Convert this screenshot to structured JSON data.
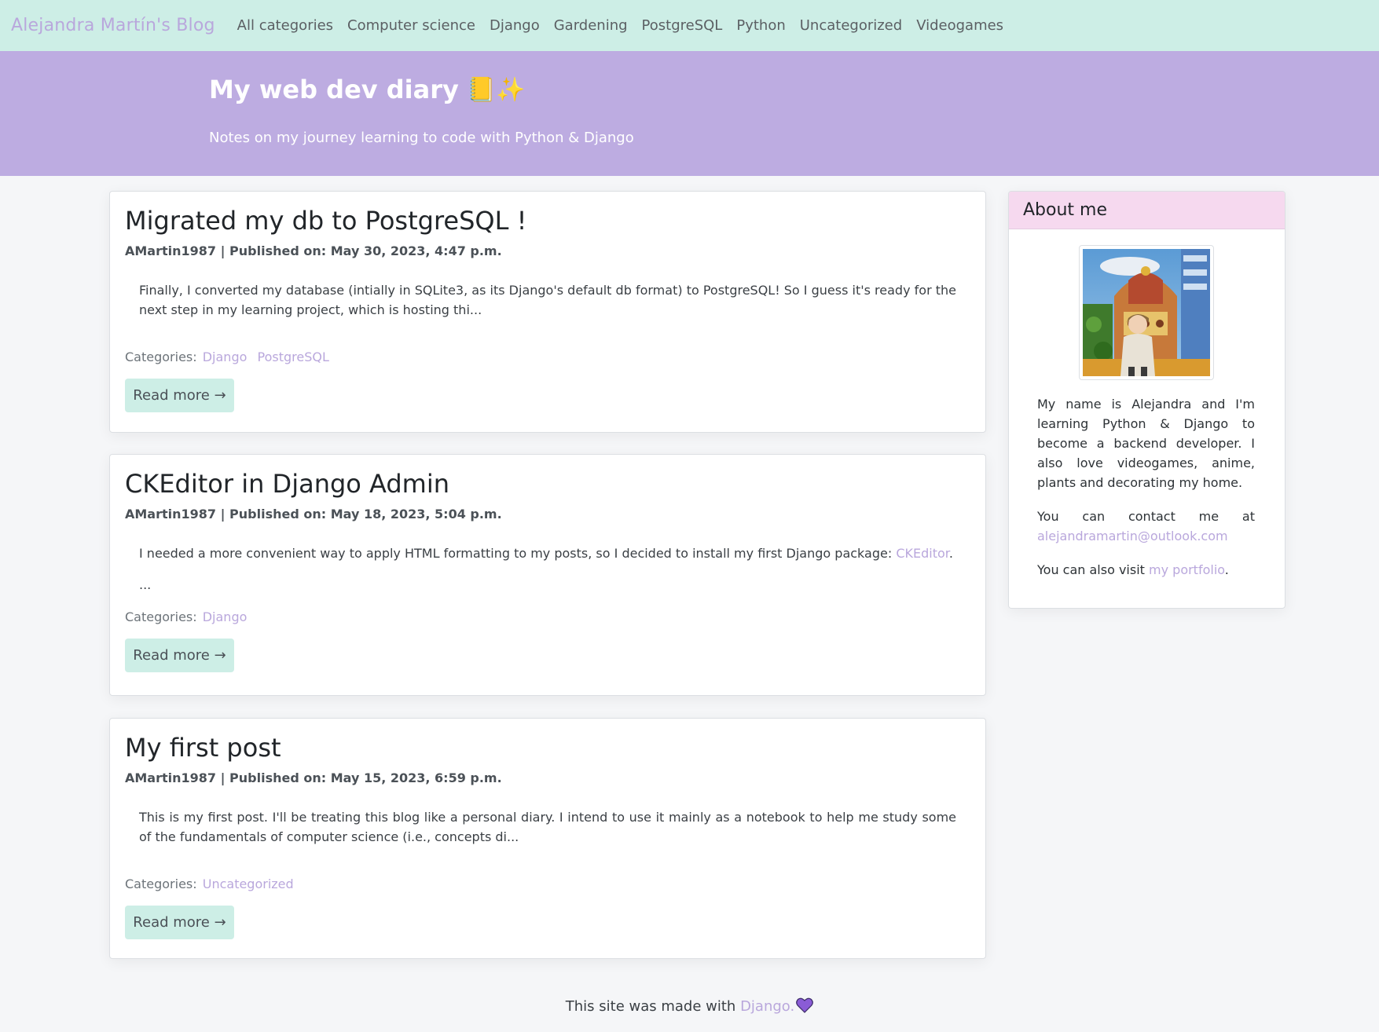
{
  "navbar": {
    "brand": "Alejandra Martín's Blog",
    "links": [
      "All categories",
      "Computer science",
      "Django",
      "Gardening",
      "PostgreSQL",
      "Python",
      "Uncategorized",
      "Videogames"
    ]
  },
  "hero": {
    "title": "My web dev diary",
    "emoji": "📒✨",
    "subtitle": "Notes on my journey learning to code with Python & Django"
  },
  "posts": [
    {
      "title": "Migrated my db to PostgreSQL !",
      "meta": "AMartin1987 | Published on: May 30, 2023, 4:47 p.m.",
      "excerpt": "Finally, I converted my database (intially in SQLite3, as its Django's default db format) to PostgreSQL! So I guess it's ready for the next step in my learning project, which is hosting thi...",
      "categories_label": "Categories:",
      "categories": [
        "Django",
        "PostgreSQL"
      ],
      "read_more": "Read more →"
    },
    {
      "title": "CKEditor in Django Admin",
      "meta": "AMartin1987 | Published on: May 18, 2023, 5:04 p.m.",
      "excerpt": "I needed a more convenient way to apply HTML formatting to my posts, so I decided to install my first Django package: ",
      "excerpt_link": "CKEditor",
      "excerpt_end": ".",
      "ellipsis": "...",
      "categories_label": "Categories:",
      "categories": [
        "Django"
      ],
      "read_more": "Read more →"
    },
    {
      "title": "My first post",
      "meta": "AMartin1987 | Published on: May 15, 2023, 6:59 p.m.",
      "excerpt": "This is my first post. I'll be treating this blog like a personal diary. I intend to use it mainly as a notebook to help me study some of the fundamentals of computer science (i.e., concepts di...",
      "categories_label": "Categories:",
      "categories": [
        "Uncategorized"
      ],
      "read_more": "Read more →"
    }
  ],
  "sidebar": {
    "heading": "About me",
    "bio": "My name is Alejandra and I'm learning Python & Django to become a backend developer. I also love videogames, anime, plants and decorating my home.",
    "contact_prefix": "You can contact me at ",
    "email": "alejandramartin@outlook.com",
    "portfolio_prefix": "You can also visit ",
    "portfolio_link": "my portfolio",
    "portfolio_suffix": "."
  },
  "footer": {
    "prefix": "This site was made with ",
    "link": "Django."
  },
  "colors": {
    "navbar_bg": "#cdeee6",
    "hero_bg": "#bdace1",
    "accent_link": "#b9a7dc",
    "about_header_bg": "#f6d9ef",
    "button_bg": "#cdeee6"
  }
}
